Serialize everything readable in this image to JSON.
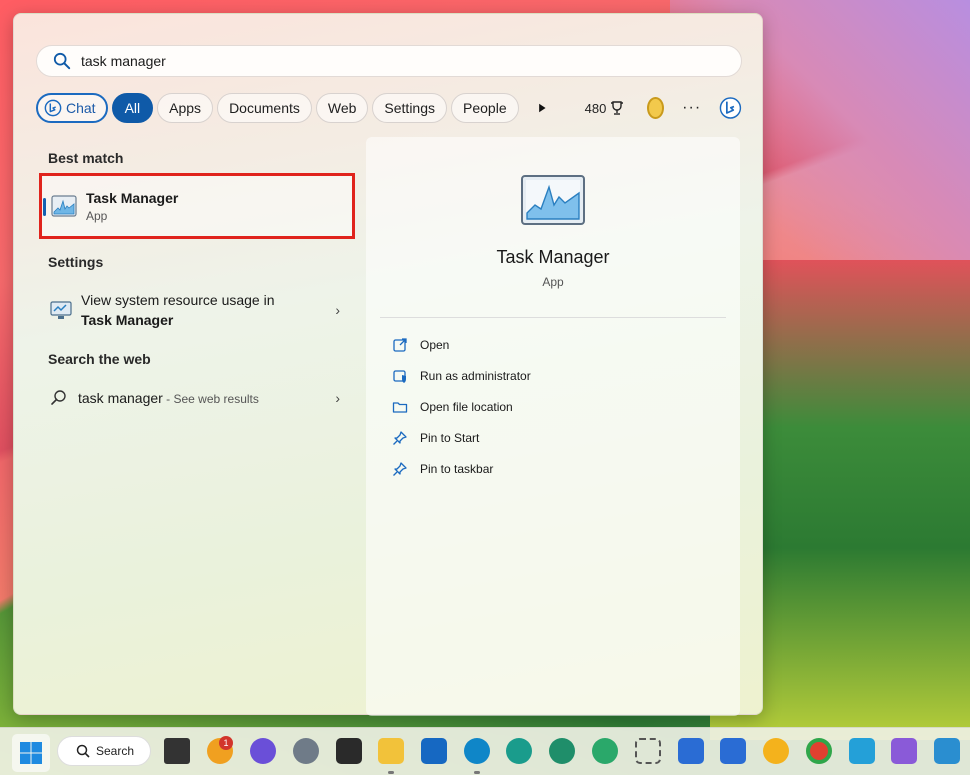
{
  "search": {
    "value": "task manager"
  },
  "filters": {
    "chat": "Chat",
    "items": [
      "All",
      "Apps",
      "Documents",
      "Web",
      "Settings",
      "People"
    ],
    "points": "480"
  },
  "best_match": {
    "label": "Best match",
    "title": "Task Manager",
    "type": "App"
  },
  "settings": {
    "label": "Settings",
    "line1": "View system resource usage in",
    "line2": "Task Manager"
  },
  "web": {
    "label": "Search the web",
    "query": "task manager",
    "suffix": " - See web results"
  },
  "preview": {
    "title": "Task Manager",
    "type": "App",
    "actions": [
      "Open",
      "Run as administrator",
      "Open file location",
      "Pin to Start",
      "Pin to taskbar"
    ]
  },
  "taskbar": {
    "search_label": "Search",
    "mail_badge": "1",
    "colors": {
      "edge": "#0f86c8",
      "chrome": "#e04030",
      "store": "#2a6cd4"
    }
  }
}
